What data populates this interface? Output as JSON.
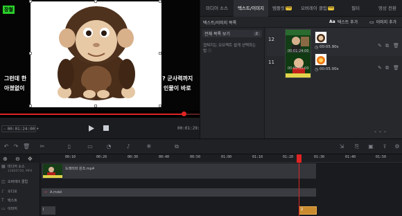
{
  "preview": {
    "subtitle_tag": "장철",
    "subtitle_left_line1": "그런데 한",
    "subtitle_left_line2": "아졌없이",
    "subtitle_right_line1": "? 군사력까지",
    "subtitle_right_line2": "인물이 바로",
    "progress": 0.92,
    "current_time": "00:01:24:00",
    "total_time": "00:01:29:60",
    "add_label": "+"
  },
  "tabs": [
    {
      "label": "미디어 소스",
      "pro": false
    },
    {
      "label": "텍스트/이미지",
      "pro": false
    },
    {
      "label": "템플릿",
      "pro": true,
      "pro_label": "Pro"
    },
    {
      "label": "오버레이 클립",
      "pro": true,
      "pro_label": "Pro"
    },
    {
      "label": "필터",
      "pro": false
    },
    {
      "label": "영상 전환",
      "pro": false
    }
  ],
  "toolbar": {
    "list_title": "텍스트/이미지 목록",
    "add_text": "텍스트 추가",
    "add_image": "이미지 추가"
  },
  "leftlist": {
    "all_label": "전체 목록 보기",
    "all_count": "2",
    "hint": "겹쳐지는 오브젝트 쉽게 선택하는 법 ⓘ"
  },
  "layers": [
    {
      "num": "12",
      "thumb_time": "00:01:24:00",
      "duration": "00:05.90s"
    },
    {
      "num": "11",
      "thumb_time": "00:00:00:00",
      "duration": "00:05.00s"
    }
  ],
  "timeline": {
    "ticks": [
      "00:10",
      "00:20",
      "00:30",
      "00:40",
      "00:50",
      "01:00",
      "01:10",
      "01:20",
      "01:30",
      "01:40",
      "01:50"
    ],
    "tracks": [
      "미디어 소스",
      "오버레이 클립",
      "오디오",
      "텍스트",
      "이미지"
    ],
    "media_sub": "1280X720, MP4",
    "clip_name": "도레미와 원조.mp4",
    "audio_name": "A.mdel",
    "image_badge": "2",
    "image_badge2": "I"
  },
  "colors": {
    "accent_red": "#e02424",
    "pro_yellow": "#e8c23a",
    "image_clip": "#c98b2e"
  }
}
